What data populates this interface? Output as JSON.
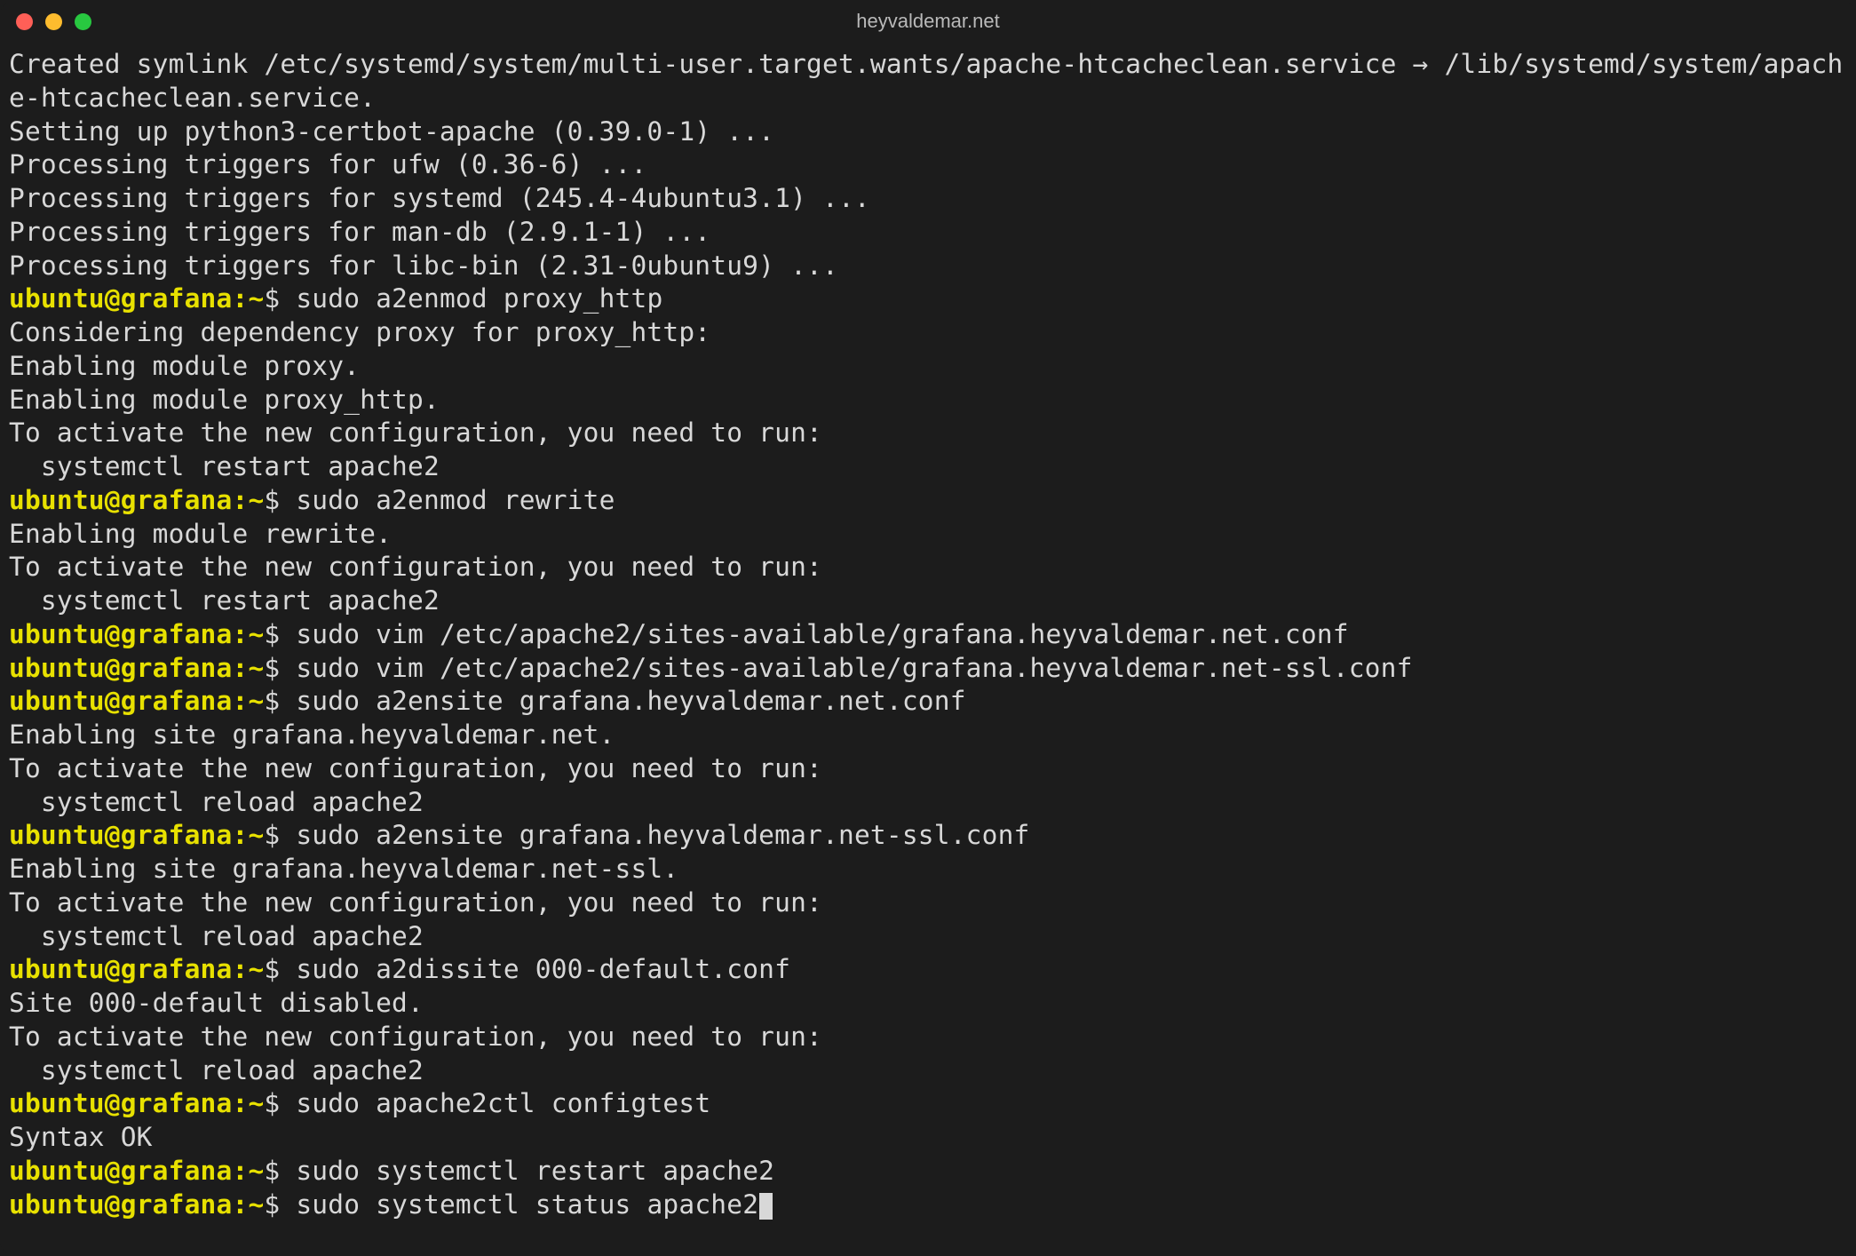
{
  "window": {
    "title": "heyvaldemar.net"
  },
  "prompt": {
    "user": "ubuntu",
    "at": "@",
    "host": "grafana",
    "colon": ":",
    "path": "~",
    "dollar": "$ "
  },
  "lines": [
    {
      "type": "out",
      "text": "Created symlink /etc/systemd/system/multi-user.target.wants/apache-htcacheclean.service → /lib/systemd/system/apache-htcacheclean.service."
    },
    {
      "type": "out",
      "text": "Setting up python3-certbot-apache (0.39.0-1) ..."
    },
    {
      "type": "out",
      "text": "Processing triggers for ufw (0.36-6) ..."
    },
    {
      "type": "out",
      "text": "Processing triggers for systemd (245.4-4ubuntu3.1) ..."
    },
    {
      "type": "out",
      "text": "Processing triggers for man-db (2.9.1-1) ..."
    },
    {
      "type": "out",
      "text": "Processing triggers for libc-bin (2.31-0ubuntu9) ..."
    },
    {
      "type": "cmd",
      "text": "sudo a2enmod proxy_http"
    },
    {
      "type": "out",
      "text": "Considering dependency proxy for proxy_http:"
    },
    {
      "type": "out",
      "text": "Enabling module proxy."
    },
    {
      "type": "out",
      "text": "Enabling module proxy_http."
    },
    {
      "type": "out",
      "text": "To activate the new configuration, you need to run:"
    },
    {
      "type": "out",
      "text": "  systemctl restart apache2"
    },
    {
      "type": "cmd",
      "text": "sudo a2enmod rewrite"
    },
    {
      "type": "out",
      "text": "Enabling module rewrite."
    },
    {
      "type": "out",
      "text": "To activate the new configuration, you need to run:"
    },
    {
      "type": "out",
      "text": "  systemctl restart apache2"
    },
    {
      "type": "cmd",
      "text": "sudo vim /etc/apache2/sites-available/grafana.heyvaldemar.net.conf"
    },
    {
      "type": "cmd",
      "text": "sudo vim /etc/apache2/sites-available/grafana.heyvaldemar.net-ssl.conf"
    },
    {
      "type": "cmd",
      "text": "sudo a2ensite grafana.heyvaldemar.net.conf"
    },
    {
      "type": "out",
      "text": "Enabling site grafana.heyvaldemar.net."
    },
    {
      "type": "out",
      "text": "To activate the new configuration, you need to run:"
    },
    {
      "type": "out",
      "text": "  systemctl reload apache2"
    },
    {
      "type": "cmd",
      "text": "sudo a2ensite grafana.heyvaldemar.net-ssl.conf"
    },
    {
      "type": "out",
      "text": "Enabling site grafana.heyvaldemar.net-ssl."
    },
    {
      "type": "out",
      "text": "To activate the new configuration, you need to run:"
    },
    {
      "type": "out",
      "text": "  systemctl reload apache2"
    },
    {
      "type": "cmd",
      "text": "sudo a2dissite 000-default.conf"
    },
    {
      "type": "out",
      "text": "Site 000-default disabled."
    },
    {
      "type": "out",
      "text": "To activate the new configuration, you need to run:"
    },
    {
      "type": "out",
      "text": "  systemctl reload apache2"
    },
    {
      "type": "cmd",
      "text": "sudo apache2ctl configtest"
    },
    {
      "type": "out",
      "text": "Syntax OK"
    },
    {
      "type": "cmd",
      "text": "sudo systemctl restart apache2"
    },
    {
      "type": "cmd",
      "text": "sudo systemctl status apache2",
      "cursor": true
    }
  ]
}
